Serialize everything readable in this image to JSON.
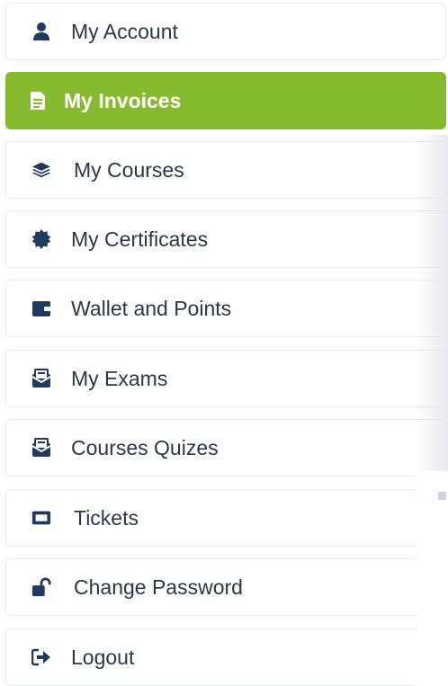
{
  "menu": {
    "items": [
      {
        "label": "My Account",
        "icon": "user-icon",
        "active": false
      },
      {
        "label": "My Invoices",
        "icon": "invoice-icon",
        "active": true
      },
      {
        "label": "My Courses",
        "icon": "layers-icon",
        "active": false
      },
      {
        "label": "My Certificates",
        "icon": "certificate-icon",
        "active": false
      },
      {
        "label": "Wallet and Points",
        "icon": "wallet-icon",
        "active": false
      },
      {
        "label": "My Exams",
        "icon": "exam-icon",
        "active": false
      },
      {
        "label": "Courses Quizes",
        "icon": "quiz-icon",
        "active": false
      },
      {
        "label": "Tickets",
        "icon": "ticket-icon",
        "active": false
      },
      {
        "label": "Change Password",
        "icon": "unlock-icon",
        "active": false
      },
      {
        "label": "Logout",
        "icon": "logout-icon",
        "active": false
      }
    ]
  },
  "colors": {
    "accent": "#86bb2f",
    "text": "#2a3747",
    "icon": "#1f3a5f",
    "border": "#e6e9ee"
  }
}
